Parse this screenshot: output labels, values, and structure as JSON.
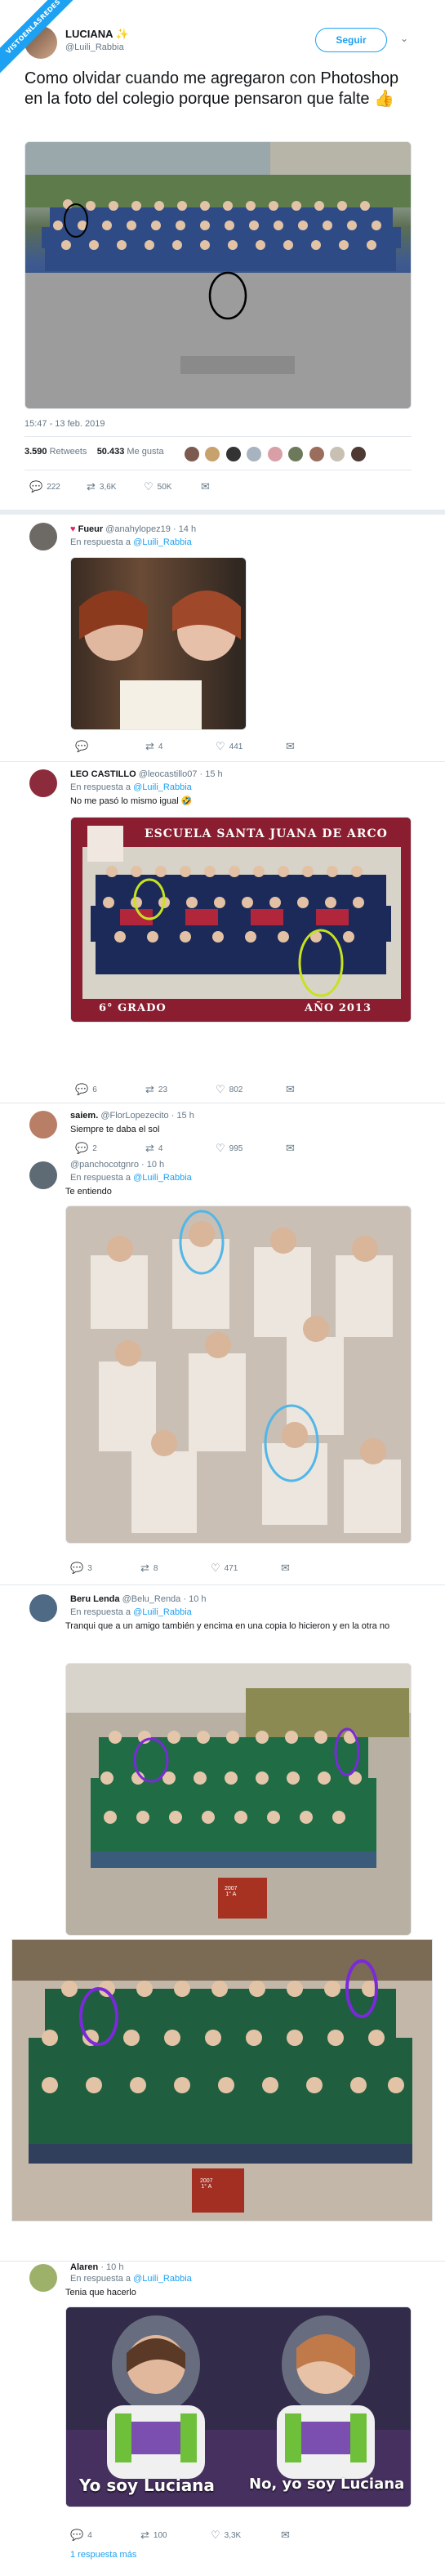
{
  "watermark": "VISTOENLASREDES",
  "main": {
    "name": "LUCIANA",
    "handle": "@Luili_Rabbia",
    "follow_label": "Seguir",
    "text": "Como olvidar cuando me agregaron con Photoshop en la foto del colegio porque pensaron que falte 👍",
    "time": "15:47 - 13 feb. 2019",
    "retweets_count": "3.590",
    "retweets_label": "Retweets",
    "likes_count": "50.433",
    "likes_label": "Me gusta",
    "actions": {
      "replies": "222",
      "retweets": "3,6K",
      "likes": "50K"
    },
    "colors": {
      "accent": "#1da1f2",
      "shirt": "#3e5a8f"
    }
  },
  "replies": [
    {
      "name": "Fueur",
      "handle": "@anahylopez19",
      "time": "14 h",
      "in_reply_prefix": "En respuesta a",
      "in_reply_to": "@Luili_Rabbia",
      "text": "",
      "actions": {
        "replies": "",
        "retweets": "4",
        "likes": "441"
      }
    },
    {
      "name": "LEO CASTILLO",
      "handle": "@leocastillo07",
      "time": "15 h",
      "in_reply_prefix": "En respuesta a",
      "in_reply_to": "@Luili_Rabbia",
      "text": "No me pasó lo mismo igual 🤣",
      "image_banner_top": "ESCUELA SANTA JUANA DE ARCO",
      "image_banner_left": "6° GRADO",
      "image_banner_right": "AÑO 2013",
      "actions": {
        "replies": "6",
        "retweets": "23",
        "likes": "802"
      }
    },
    {
      "name": "saiem.",
      "handle": "@FlorLopezecito",
      "time": "15 h",
      "text": "Siempre te daba el sol",
      "actions": {
        "replies": "2",
        "retweets": "4",
        "likes": "995"
      }
    },
    {
      "name": "",
      "handle": "@panchocotgnro",
      "time": "10 h",
      "in_reply_prefix": "En respuesta a",
      "in_reply_to": "@Luili_Rabbia",
      "text": "Te entiendo",
      "actions": {
        "replies": "3",
        "retweets": "8",
        "likes": "471"
      }
    },
    {
      "name": "Beru Lenda",
      "handle": "@Belu_Renda",
      "time": "10 h",
      "in_reply_prefix": "En respuesta a",
      "in_reply_to": "@Luili_Rabbia",
      "text": "Tranqui que a un amigo también y encima en una copia lo hicieron y en la otra no",
      "image_sign_1": "2007\n1° A",
      "image_sign_2": "2007\n1° A"
    },
    {
      "name": "Alaren",
      "handle": "",
      "time": "10 h",
      "in_reply_prefix": "En respuesta a",
      "in_reply_to": "@Luili_Rabbia",
      "text": "Tenia que hacerlo",
      "caption_left": "Yo soy Luciana",
      "caption_right": "No, yo soy Luciana",
      "actions": {
        "replies": "4",
        "retweets": "100",
        "likes": "3,3K"
      },
      "more_label": "1 respuesta más"
    }
  ]
}
